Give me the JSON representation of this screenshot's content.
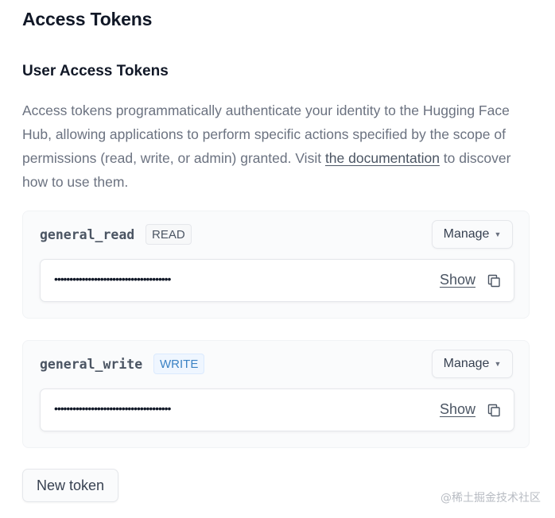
{
  "page": {
    "title": "Access Tokens"
  },
  "section": {
    "title": "User Access Tokens",
    "description_prefix": "Access tokens programmatically authenticate your identity to the Hugging Face Hub, allowing applications to perform specific actions specified by the scope of permissions (read, write, or admin) granted. Visit ",
    "description_link": "the documentation",
    "description_suffix": " to discover how to use them."
  },
  "tokens": [
    {
      "name": "general_read",
      "role": "READ",
      "manage_label": "Manage",
      "secret_masked": "••••••••••••••••••••••••••••••••••••••",
      "show_label": "Show"
    },
    {
      "name": "general_write",
      "role": "WRITE",
      "manage_label": "Manage",
      "secret_masked": "••••••••••••••••••••••••••••••••••••••",
      "show_label": "Show"
    }
  ],
  "new_token_label": "New token",
  "watermark": "@稀土掘金技术社区",
  "icons": {
    "manage_caret": "chevron-down-icon",
    "copy": "copy-icon"
  },
  "colors": {
    "read_badge_text": "#4b5563",
    "write_badge_text": "#3b82c4",
    "write_badge_bg": "#eff6ff"
  }
}
